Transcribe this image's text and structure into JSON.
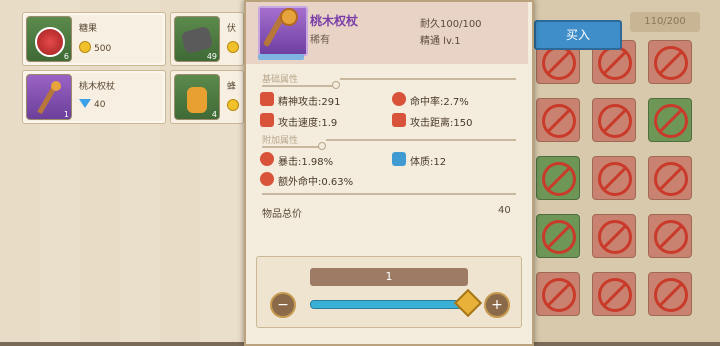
{
  "shop": {
    "items": [
      {
        "name": "糖果",
        "price": "500",
        "currency": "coin",
        "qty": "6",
        "icon": "candy-icon"
      },
      {
        "name": "伏",
        "price": "",
        "currency": "coin",
        "qty": "49",
        "icon": "ore-icon"
      },
      {
        "name": "桃木权杖",
        "price": "40",
        "currency": "gem",
        "qty": "1",
        "icon": "wand-icon"
      },
      {
        "name": "蜂",
        "price": "",
        "currency": "coin",
        "qty": "4",
        "icon": "honey-icon"
      }
    ]
  },
  "inventory": {
    "capacity": "110/200"
  },
  "buy_button": {
    "label": "买入"
  },
  "tooltip": {
    "title": "桃木权杖",
    "rarity": "稀有",
    "durability": "耐久100/100",
    "level": "精通 lv.1",
    "basic_section": "基础属性",
    "basic_stats": [
      {
        "label": "精神攻击:291",
        "icon": "sword-icon"
      },
      {
        "label": "命中率:2.7%",
        "icon": "target-icon"
      },
      {
        "label": "攻击速度:1.9",
        "icon": "sword-icon"
      },
      {
        "label": "攻击距离:150",
        "icon": "sword-icon"
      }
    ],
    "extra_section": "附加属性",
    "extra_stats": [
      {
        "label": "暴击:1.98%",
        "icon": "burst-icon"
      },
      {
        "label": "体质:12",
        "icon": "body-icon"
      },
      {
        "label": "额外命中:0.63%",
        "icon": "target-icon"
      }
    ],
    "total_label": "物品总价",
    "total_value": "40",
    "quantity": "1",
    "slider_fraction": 1.0
  },
  "colors": {
    "accent": "#3f8ec9",
    "rarity_purple": "#7a3fa8",
    "ban_red": "#c93a2a"
  }
}
